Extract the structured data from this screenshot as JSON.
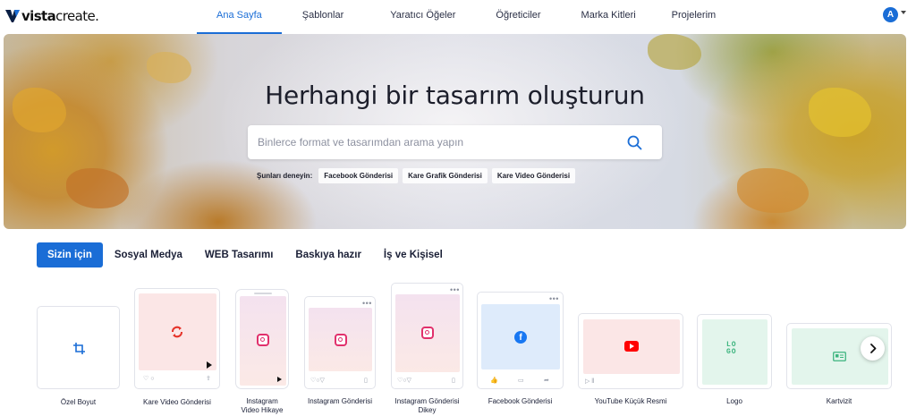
{
  "app": {
    "brand_bold": "vista",
    "brand_light": "create",
    "brand_dot": ".",
    "accent_color": "#1a6dd6"
  },
  "nav": {
    "items": [
      {
        "label": "Ana Sayfa",
        "active": true
      },
      {
        "label": "Şablonlar"
      },
      {
        "label": "Yaratıcı Öğeler"
      },
      {
        "label": "Öğreticiler"
      },
      {
        "label": "Marka Kitleri"
      },
      {
        "label": "Projelerim"
      }
    ],
    "avatar_initial": "A"
  },
  "hero": {
    "title": "Herhangi bir tasarım oluşturun",
    "search_placeholder": "Binlerce format ve tasarımdan arama yapın",
    "try_label": "Şunları deneyin:",
    "suggestions": [
      "Facebook Gönderisi",
      "Kare Grafik Gönderisi",
      "Kare Video Gönderisi"
    ]
  },
  "tabs": [
    {
      "label": "Sizin için",
      "active": true
    },
    {
      "label": "Sosyal Medya"
    },
    {
      "label": "WEB Tasarımı"
    },
    {
      "label": "Baskıya hazır"
    },
    {
      "label": "İş ve Kişisel"
    }
  ],
  "cards": [
    {
      "label": "Özel Boyut",
      "icon": "crop-icon"
    },
    {
      "label": "Kare Video Gönderisi",
      "icon": "refresh-icon"
    },
    {
      "label_lines": [
        "Instagram",
        "Video Hikaye"
      ],
      "icon": "instagram-icon"
    },
    {
      "label": "Instagram Gönderisi",
      "icon": "instagram-icon"
    },
    {
      "label_lines": [
        "Instagram Gönderisi",
        "Dikey"
      ],
      "icon": "instagram-icon"
    },
    {
      "label": "Facebook Gönderisi",
      "icon": "facebook-icon"
    },
    {
      "label": "YouTube Küçük Resmi",
      "icon": "youtube-icon"
    },
    {
      "label": "Logo",
      "icon": "logo-icon",
      "logo_text": [
        "LO",
        "GO"
      ]
    },
    {
      "label": "Kartvizit",
      "icon": "id-card-icon"
    }
  ],
  "colors": {
    "pink_card": "#fbe6e6",
    "instagram_gradient_top": "#f4e2ef",
    "instagram_gradient_bottom": "#fbe9e6",
    "facebook_blue": "#1877f2",
    "facebook_bg": "#deebfb",
    "youtube_red": "#ff0000",
    "logo_green": "#3cb47e",
    "green_bg": "#e3f5ec"
  }
}
